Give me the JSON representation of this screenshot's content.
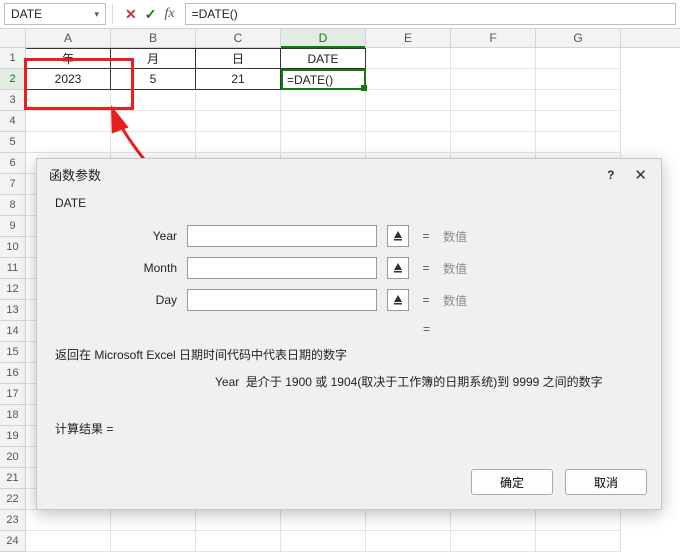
{
  "formula_bar": {
    "namebox": "DATE",
    "formula": "=DATE()"
  },
  "columns": [
    "A",
    "B",
    "C",
    "D",
    "E",
    "F",
    "G"
  ],
  "row_labels": [
    "1",
    "2",
    "3",
    "4",
    "5",
    "6",
    "7",
    "8",
    "9",
    "10",
    "11",
    "12",
    "13",
    "14",
    "15",
    "16",
    "17",
    "18",
    "19",
    "20",
    "21",
    "22",
    "23",
    "24"
  ],
  "active": {
    "col": "D",
    "row": "2",
    "display": "=DATE()"
  },
  "table": {
    "headers": [
      "年",
      "月",
      "日",
      "DATE"
    ],
    "row": [
      "2023",
      "5",
      "21"
    ]
  },
  "dialog": {
    "title": "函数参数",
    "help": "?",
    "fn_name": "DATE",
    "args": [
      {
        "label": "Year",
        "value": "",
        "hint": "数值"
      },
      {
        "label": "Month",
        "value": "",
        "hint": "数值"
      },
      {
        "label": "Day",
        "value": "",
        "hint": "数值"
      }
    ],
    "eq": "=",
    "argeq": "=",
    "description": "返回在 Microsoft Excel 日期时间代码中代表日期的数字",
    "arg_desc_label": "Year",
    "arg_desc": "是介于 1900 或 1904(取决于工作簿的日期系统)到 9999 之间的数字",
    "result_label": "计算结果 =",
    "ok": "确定",
    "cancel": "取消"
  }
}
